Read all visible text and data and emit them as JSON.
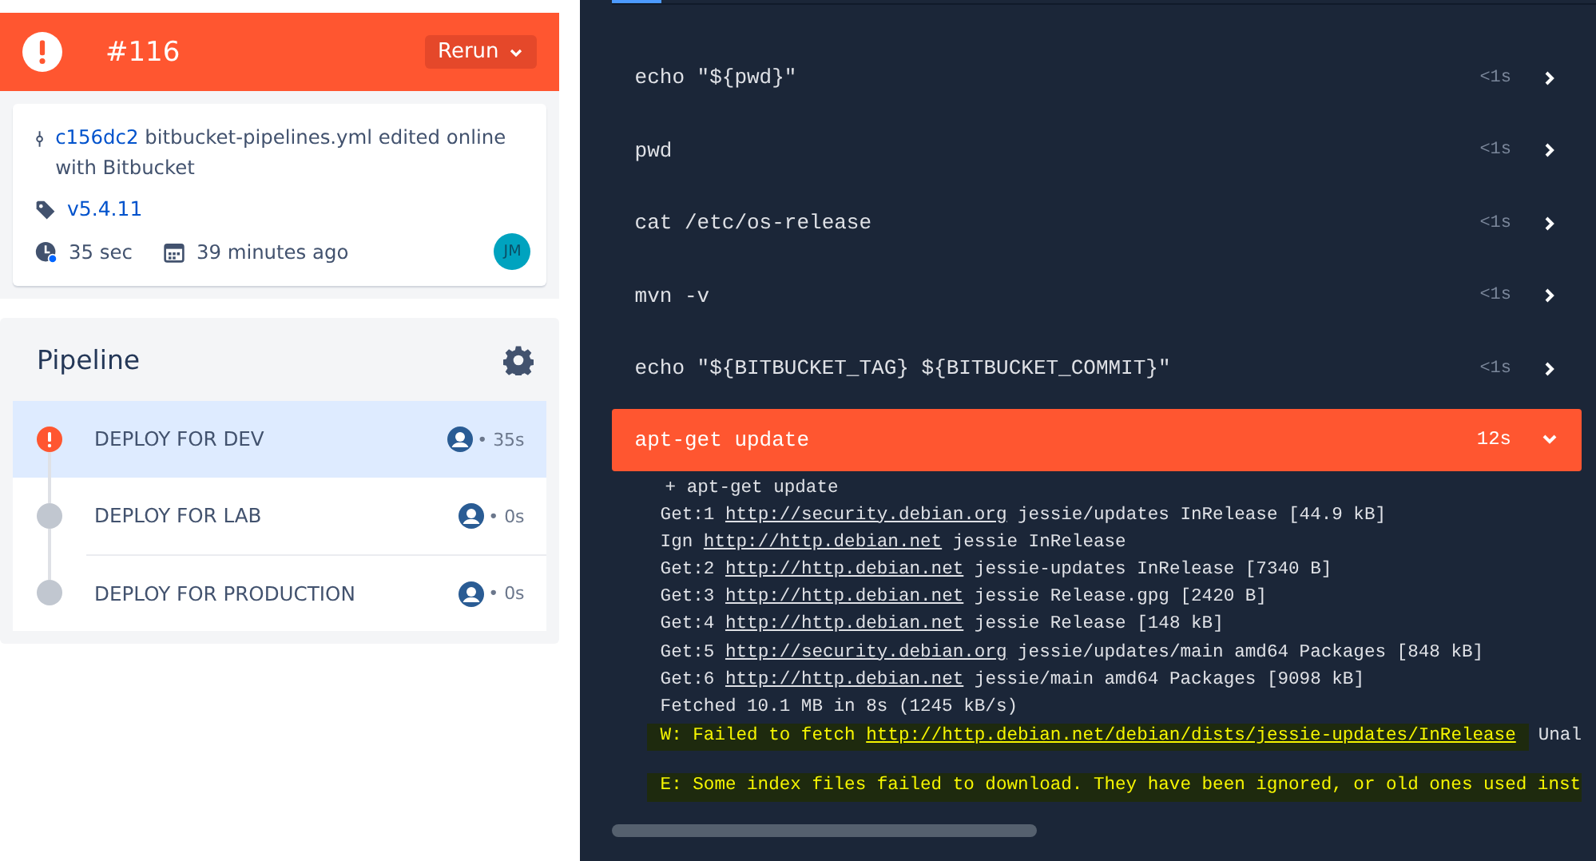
{
  "build": {
    "failed": true,
    "number": "#116",
    "rerun_button": "Rerun"
  },
  "commit": {
    "hash": "c156dc2",
    "message": "bitbucket-pipelines.yml edited online with Bitbucket",
    "tag": "v5.4.11",
    "duration": "35 sec",
    "time": "39 minutes ago",
    "avatar_initials": "JM"
  },
  "pipeline": {
    "title": "Pipeline",
    "steps": [
      {
        "name": "DEPLOY FOR DEV",
        "duration": "• 35s",
        "failed": true,
        "selected": true
      },
      {
        "name": "DEPLOY FOR LAB",
        "duration": "• 0s",
        "failed": false,
        "selected": false
      },
      {
        "name": "DEPLOY FOR PRODUCTION",
        "duration": "• 0s",
        "failed": false,
        "selected": false
      }
    ]
  },
  "commands": [
    {
      "command": "echo \"${pwd}\"",
      "duration": "<1s",
      "failed": false,
      "expanded": false
    },
    {
      "command": "pwd",
      "duration": "<1s",
      "failed": false,
      "expanded": false
    },
    {
      "command": "cat /etc/os-release",
      "duration": "<1s",
      "failed": false,
      "expanded": false
    },
    {
      "command": "mvn -v",
      "duration": "<1s",
      "failed": false,
      "expanded": false
    },
    {
      "command": "echo \"${BITBUCKET_TAG} ${BITBUCKET_COMMIT}\"",
      "duration": "<1s",
      "failed": false,
      "expanded": false
    },
    {
      "command": "apt-get update",
      "duration": "12s",
      "failed": true,
      "expanded": true
    }
  ],
  "log": [
    {
      "kind": "command",
      "parts": [
        {
          "text": "+ apt-get update",
          "link": false
        }
      ]
    },
    {
      "kind": "normal",
      "parts": [
        {
          "text": "Get:1 ",
          "link": false
        },
        {
          "text": "http://security.debian.org",
          "link": true
        },
        {
          "text": " jessie/updates InRelease [44.9 kB]",
          "link": false
        }
      ]
    },
    {
      "kind": "normal",
      "parts": [
        {
          "text": "Ign ",
          "link": false
        },
        {
          "text": "http://http.debian.net",
          "link": true
        },
        {
          "text": " jessie InRelease",
          "link": false
        }
      ]
    },
    {
      "kind": "normal",
      "parts": [
        {
          "text": "Get:2 ",
          "link": false
        },
        {
          "text": "http://http.debian.net",
          "link": true
        },
        {
          "text": " jessie-updates InRelease [7340 B]",
          "link": false
        }
      ]
    },
    {
      "kind": "normal",
      "parts": [
        {
          "text": "Get:3 ",
          "link": false
        },
        {
          "text": "http://http.debian.net",
          "link": true
        },
        {
          "text": " jessie Release.gpg [2420 B]",
          "link": false
        }
      ]
    },
    {
      "kind": "normal",
      "parts": [
        {
          "text": "Get:4 ",
          "link": false
        },
        {
          "text": "http://http.debian.net",
          "link": true
        },
        {
          "text": " jessie Release [148 kB]",
          "link": false
        }
      ]
    },
    {
      "kind": "normal",
      "parts": [
        {
          "text": "Get:5 ",
          "link": false
        },
        {
          "text": "http://security.debian.org",
          "link": true
        },
        {
          "text": " jessie/updates/main amd64 Packages [848 kB]",
          "link": false
        }
      ]
    },
    {
      "kind": "normal",
      "parts": [
        {
          "text": "Get:6 ",
          "link": false
        },
        {
          "text": "http://http.debian.net",
          "link": true
        },
        {
          "text": " jessie/main amd64 Packages [9098 kB]",
          "link": false
        }
      ]
    },
    {
      "kind": "normal",
      "parts": [
        {
          "text": "Fetched 10.1 MB in 8s (1245 kB/s)",
          "link": false
        }
      ]
    },
    {
      "kind": "warning",
      "parts": [
        {
          "text": "W: Failed to fetch ",
          "link": false
        },
        {
          "text": "http://http.debian.net/debian/dists/jessie-updates/InRelease",
          "link": true
        }
      ],
      "trailing": "Unal"
    },
    {
      "kind": "error",
      "parts": [
        {
          "text": "E: Some index files failed to download. They have been ignored, or old ones used inst",
          "link": false
        }
      ]
    }
  ]
}
